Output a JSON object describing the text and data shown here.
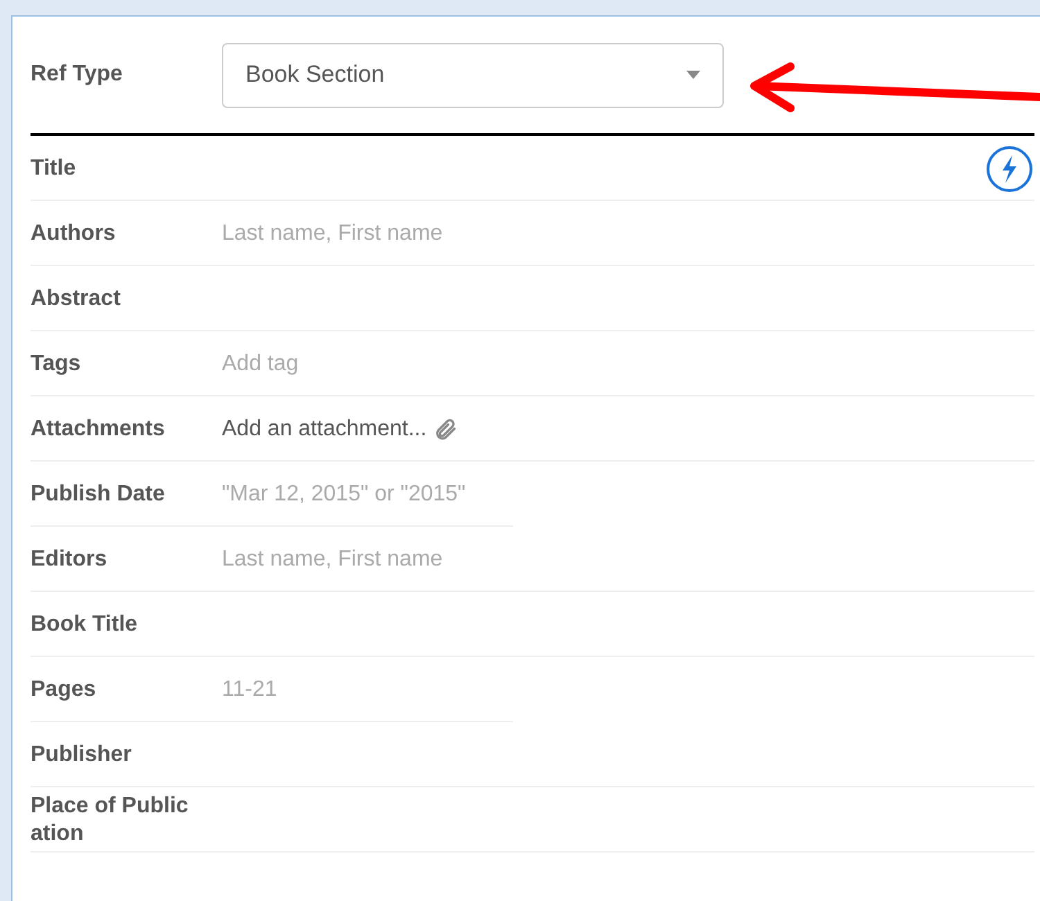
{
  "ref_type": {
    "label": "Ref Type",
    "value": "Book Section"
  },
  "fields": [
    {
      "label": "Title",
      "kind": "empty",
      "action_icon": true,
      "compact": false
    },
    {
      "label": "Authors",
      "kind": "placeholder",
      "placeholder": "Last name, First name",
      "compact": false
    },
    {
      "label": "Abstract",
      "kind": "empty",
      "compact": false
    },
    {
      "label": "Tags",
      "kind": "placeholder",
      "placeholder": "Add tag",
      "compact": false
    },
    {
      "label": "Attachments",
      "kind": "attachment",
      "text": "Add an attachment...",
      "compact": false
    },
    {
      "label": "Publish Date",
      "kind": "placeholder",
      "placeholder": "\"Mar 12, 2015\" or \"2015\"",
      "compact": true
    },
    {
      "label": "Editors",
      "kind": "placeholder",
      "placeholder": "Last name, First name",
      "compact": false
    },
    {
      "label": "Book Title",
      "kind": "empty",
      "compact": false
    },
    {
      "label": "Pages",
      "kind": "placeholder",
      "placeholder": "11-21",
      "compact": true
    },
    {
      "label": "Publisher",
      "kind": "empty",
      "compact": false
    },
    {
      "label": "Place of Publication",
      "kind": "empty",
      "compact": false
    }
  ]
}
